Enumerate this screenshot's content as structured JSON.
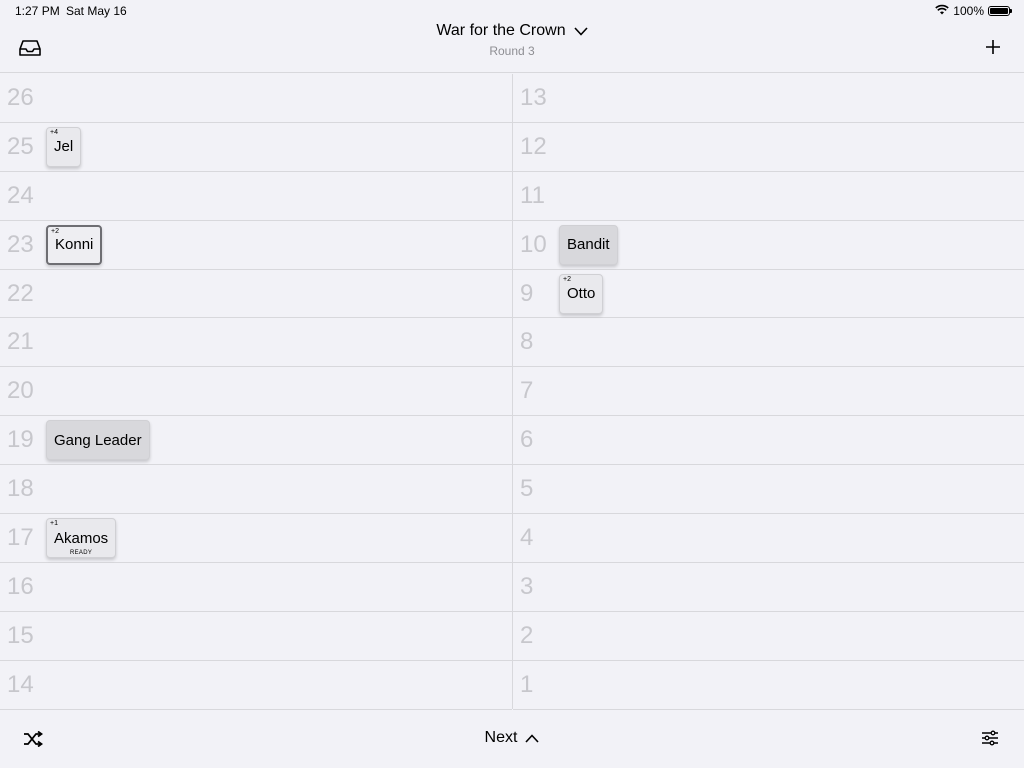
{
  "status": {
    "time": "1:27 PM",
    "date": "Sat May 16",
    "battery": "100%"
  },
  "nav": {
    "title": "War for the Crown",
    "subtitle": "Round 3"
  },
  "toolbar": {
    "next_label": "Next"
  },
  "columns": {
    "left": [
      {
        "num": "26"
      },
      {
        "num": "25",
        "chip": {
          "name": "Jel",
          "mod": "+4",
          "status": ""
        }
      },
      {
        "num": "24"
      },
      {
        "num": "23",
        "chip": {
          "name": "Konni",
          "mod": "+2",
          "status": "",
          "selected": true
        }
      },
      {
        "num": "22"
      },
      {
        "num": "21"
      },
      {
        "num": "20"
      },
      {
        "num": "19",
        "chip": {
          "name": "Gang Leader",
          "mod": "",
          "status": "",
          "dark": true
        }
      },
      {
        "num": "18"
      },
      {
        "num": "17",
        "chip": {
          "name": "Akamos",
          "mod": "+1",
          "status": "READY"
        }
      },
      {
        "num": "16"
      },
      {
        "num": "15"
      },
      {
        "num": "14"
      }
    ],
    "right": [
      {
        "num": "13"
      },
      {
        "num": "12"
      },
      {
        "num": "11"
      },
      {
        "num": "10",
        "chip": {
          "name": "Bandit",
          "mod": "",
          "status": "",
          "dark": true
        }
      },
      {
        "num": "9",
        "chip": {
          "name": "Otto",
          "mod": "+2",
          "status": ""
        }
      },
      {
        "num": "8"
      },
      {
        "num": "7"
      },
      {
        "num": "6"
      },
      {
        "num": "5"
      },
      {
        "num": "4"
      },
      {
        "num": "3"
      },
      {
        "num": "2"
      },
      {
        "num": "1"
      }
    ]
  }
}
